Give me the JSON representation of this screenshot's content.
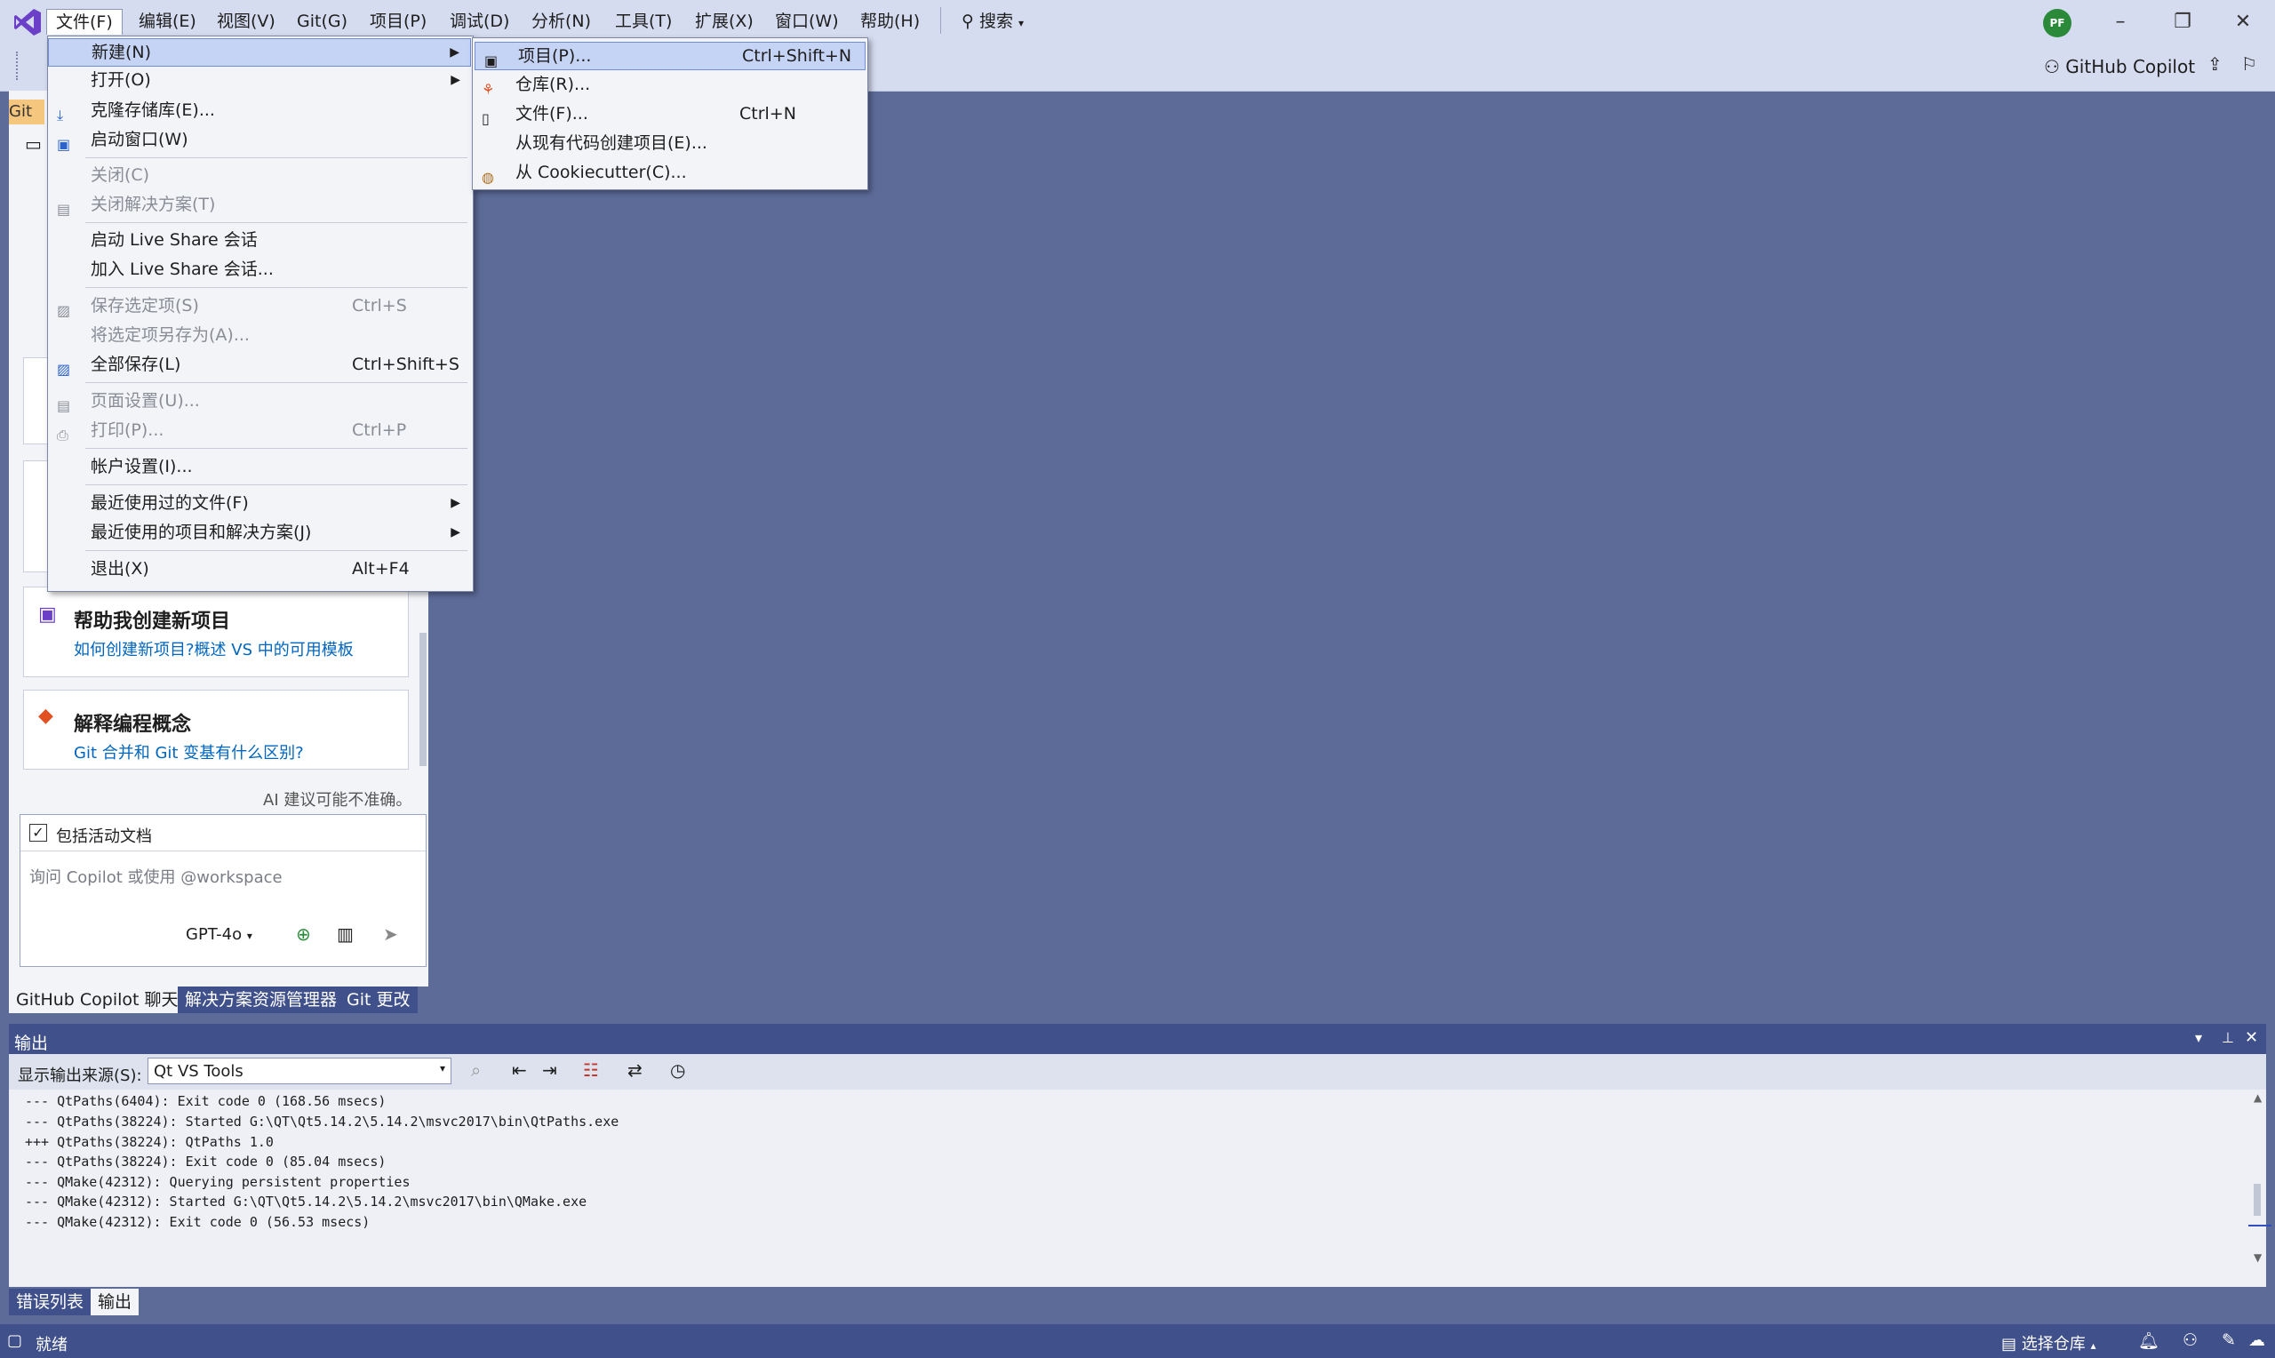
{
  "menubar": {
    "items": [
      "文件(F)",
      "编辑(E)",
      "视图(V)",
      "Git(G)",
      "项目(P)",
      "调试(D)",
      "分析(N)",
      "工具(T)",
      "扩展(X)",
      "窗口(W)",
      "帮助(H)"
    ],
    "search_label": "搜索",
    "avatar_initials": "PF"
  },
  "toolbar": {
    "copilot_label": "GitHub Copilot"
  },
  "file_menu": {
    "new": "新建(N)",
    "open": "打开(O)",
    "clone": "克隆存储库(E)...",
    "start_window": "启动窗口(W)",
    "close": "关闭(C)",
    "close_solution": "关闭解决方案(T)",
    "start_live_share": "启动 Live Share 会话",
    "join_live_share": "加入 Live Share 会话...",
    "save_selected": "保存选定项(S)",
    "save_selected_sc": "Ctrl+S",
    "save_as": "将选定项另存为(A)...",
    "save_all": "全部保存(L)",
    "save_all_sc": "Ctrl+Shift+S",
    "page_setup": "页面设置(U)...",
    "print": "打印(P)...",
    "print_sc": "Ctrl+P",
    "account_settings": "帐户设置(I)...",
    "recent_files": "最近使用过的文件(F)",
    "recent_projects": "最近使用的项目和解决方案(J)",
    "exit": "退出(X)",
    "exit_sc": "Alt+F4"
  },
  "new_submenu": {
    "project": "项目(P)...",
    "project_sc": "Ctrl+Shift+N",
    "repository": "仓库(R)...",
    "file": "文件(F)...",
    "file_sc": "Ctrl+N",
    "from_existing": "从现有代码创建项目(E)...",
    "cookiecutter": "从 Cookiecutter(C)..."
  },
  "left_panel": {
    "tab_stub": "Git",
    "card1_title": "帮助我创建新项目",
    "card1_link": "如何创建新项目?概述 VS 中的可用模板",
    "card2_title": "解释编程概念",
    "card2_link": "Git 合并和 Git 变基有什么区别?",
    "disclaimer": "AI 建议可能不准确。",
    "include_doc": "包括活动文档",
    "input_placeholder": "询问 Copilot 或使用 @workspace",
    "model": "GPT-4o",
    "tabs": [
      "GitHub Copilot 聊天",
      "解决方案资源管理器",
      "Git 更改"
    ]
  },
  "output": {
    "title": "输出",
    "source_label": "显示输出来源(S):",
    "source_value": "Qt VS Tools",
    "lines": [
      "--- QtPaths(6404): Exit code 0 (168.56 msecs)",
      "--- QtPaths(38224): Started G:\\QT\\Qt5.14.2\\5.14.2\\msvc2017\\bin\\QtPaths.exe",
      "+++ QtPaths(38224): QtPaths 1.0",
      "--- QtPaths(38224): Exit code 0 (85.04 msecs)",
      "--- QMake(42312): Querying persistent properties",
      "--- QMake(42312): Started G:\\QT\\Qt5.14.2\\5.14.2\\msvc2017\\bin\\QMake.exe",
      "--- QMake(42312): Exit code 0 (56.53 msecs)"
    ],
    "bottom_tabs": [
      "错误列表",
      "输出"
    ]
  },
  "statusbar": {
    "ready": "就绪",
    "repo": "选择仓库"
  }
}
